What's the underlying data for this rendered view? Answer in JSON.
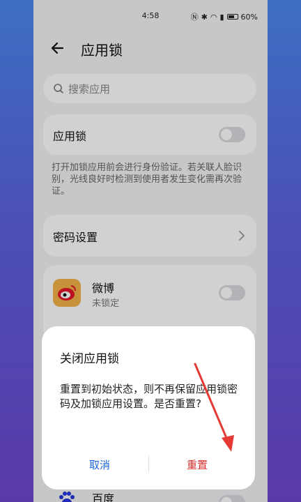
{
  "status_bar": {
    "time": "4:58",
    "battery": "60%"
  },
  "header": {
    "title": "应用锁"
  },
  "search": {
    "placeholder": "搜索应用"
  },
  "app_lock": {
    "label": "应用锁",
    "enabled": false,
    "description": "打开加锁应用前会进行身份验证。若关联人脸识别，光线良好时检测到使用者发生变化需再次验证。"
  },
  "password_settings": {
    "label": "密码设置"
  },
  "apps": [
    {
      "name": "微博",
      "status": "未锁定",
      "locked": false
    },
    {
      "name": "百度",
      "status": "",
      "locked": false
    }
  ],
  "dialog": {
    "title": "关闭应用锁",
    "message": "重置到初始状态，则不再保留应用锁密码及加锁应用设置。是否重置?",
    "cancel": "取消",
    "confirm": "重置"
  },
  "colors": {
    "accent": "#1a66d6",
    "danger": "#d92f2f",
    "annotation_arrow": "#e53935"
  }
}
